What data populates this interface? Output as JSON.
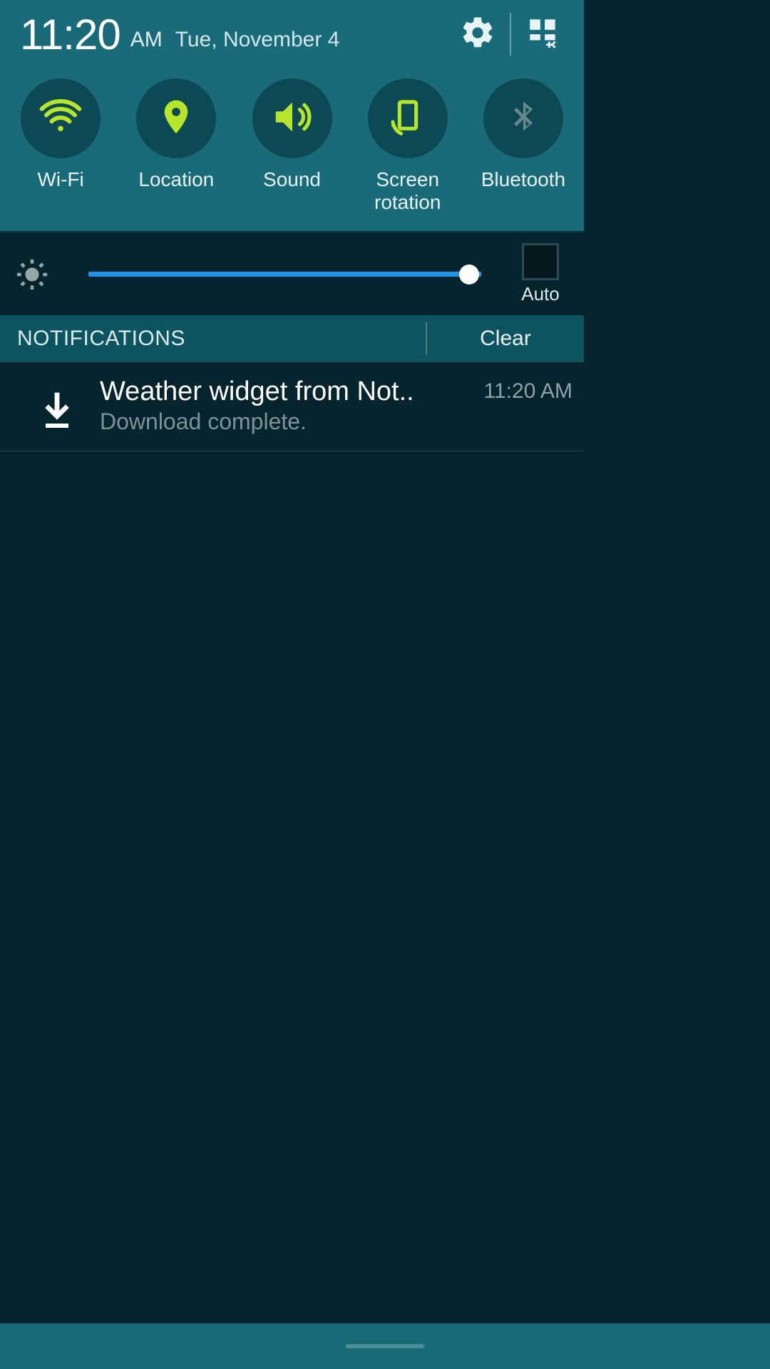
{
  "header": {
    "time": "11:20",
    "ampm": "AM",
    "date": "Tue, November 4"
  },
  "toggles": [
    {
      "id": "wifi",
      "label": "Wi-Fi",
      "active": true
    },
    {
      "id": "location",
      "label": "Location",
      "active": true
    },
    {
      "id": "sound",
      "label": "Sound",
      "active": true
    },
    {
      "id": "rotation",
      "label": "Screen\nrotation",
      "active": true
    },
    {
      "id": "bluetooth",
      "label": "Bluetooth",
      "active": false
    }
  ],
  "brightness": {
    "percent": 97,
    "auto_label": "Auto",
    "auto_checked": false
  },
  "notifications_bar": {
    "title": "NOTIFICATIONS",
    "clear_label": "Clear"
  },
  "notifications": [
    {
      "title": "Weather widget from Not..",
      "subtitle": "Download complete.",
      "time": "11:20 AM"
    }
  ],
  "colors": {
    "accent_active": "#b6e52a",
    "accent_inactive": "#6a878e",
    "panel": "#1a6b7a",
    "brightness_track": "#2094ea"
  }
}
